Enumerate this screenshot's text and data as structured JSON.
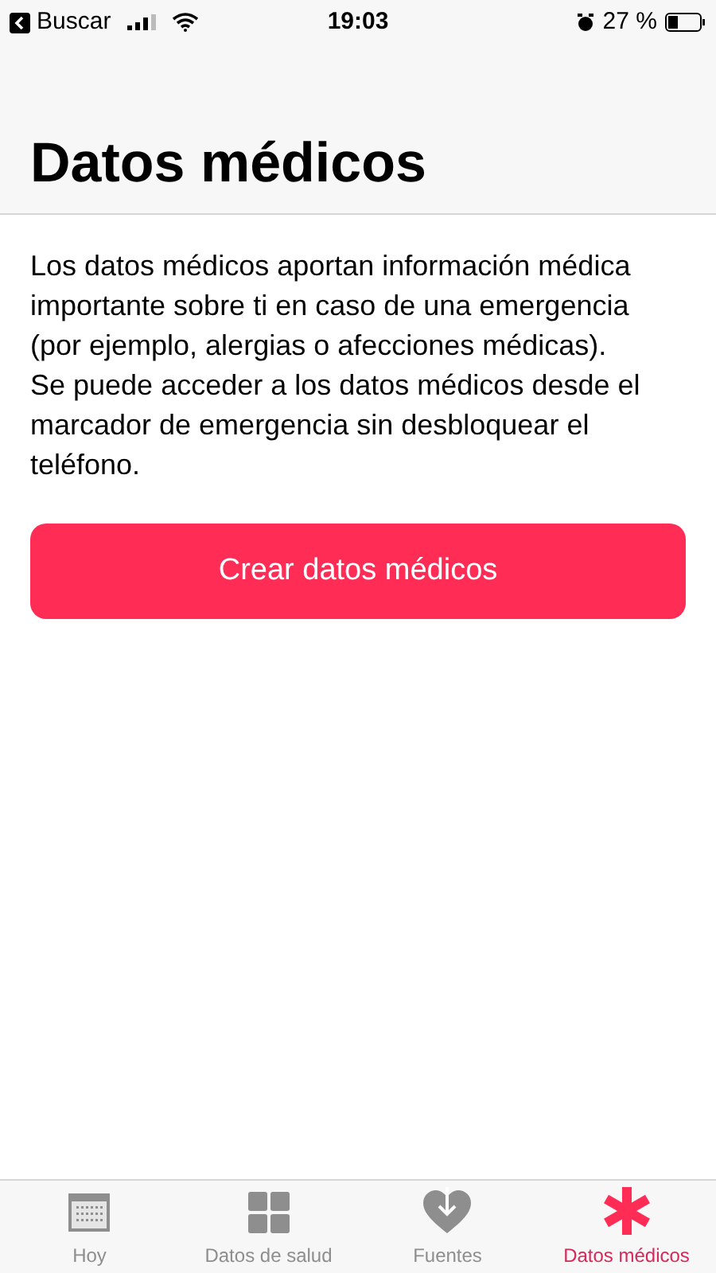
{
  "status_bar": {
    "back_label": "Buscar",
    "time": "19:03",
    "battery_text": "27 %"
  },
  "title": "Datos médicos",
  "paragraphs": [
    "Los datos médicos aportan información médica importante sobre ti en caso de una emergencia (por ejemplo, alergias o afecciones médicas).",
    "Se puede acceder a los datos médicos desde el marcador de emergencia sin desbloquear el teléfono."
  ],
  "primary_button": "Crear datos médicos",
  "tabs": [
    {
      "kind": "today",
      "label": "Hoy",
      "selected": false
    },
    {
      "kind": "grid",
      "label": "Datos de salud",
      "selected": false
    },
    {
      "kind": "heart",
      "label": "Fuentes",
      "selected": false
    },
    {
      "kind": "medical",
      "label": "Datos médicos",
      "selected": true
    }
  ]
}
